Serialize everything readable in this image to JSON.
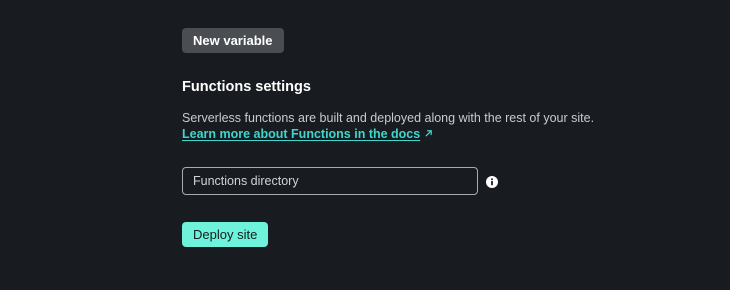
{
  "buttons": {
    "new_variable": "New variable",
    "deploy_site": "Deploy site"
  },
  "functions": {
    "title": "Functions settings",
    "description": "Serverless functions are built and deployed along with the rest of your site.",
    "docs_link": "Learn more about Functions in the docs",
    "docs_link_icon": "external-arrow-icon",
    "directory_placeholder": "Functions directory",
    "directory_value": "",
    "info_icon": "info-icon"
  },
  "colors": {
    "background": "#181b1f",
    "accent": "#6ff2dc",
    "link": "#3fd6cd",
    "secondary_button": "#4a4e53"
  }
}
